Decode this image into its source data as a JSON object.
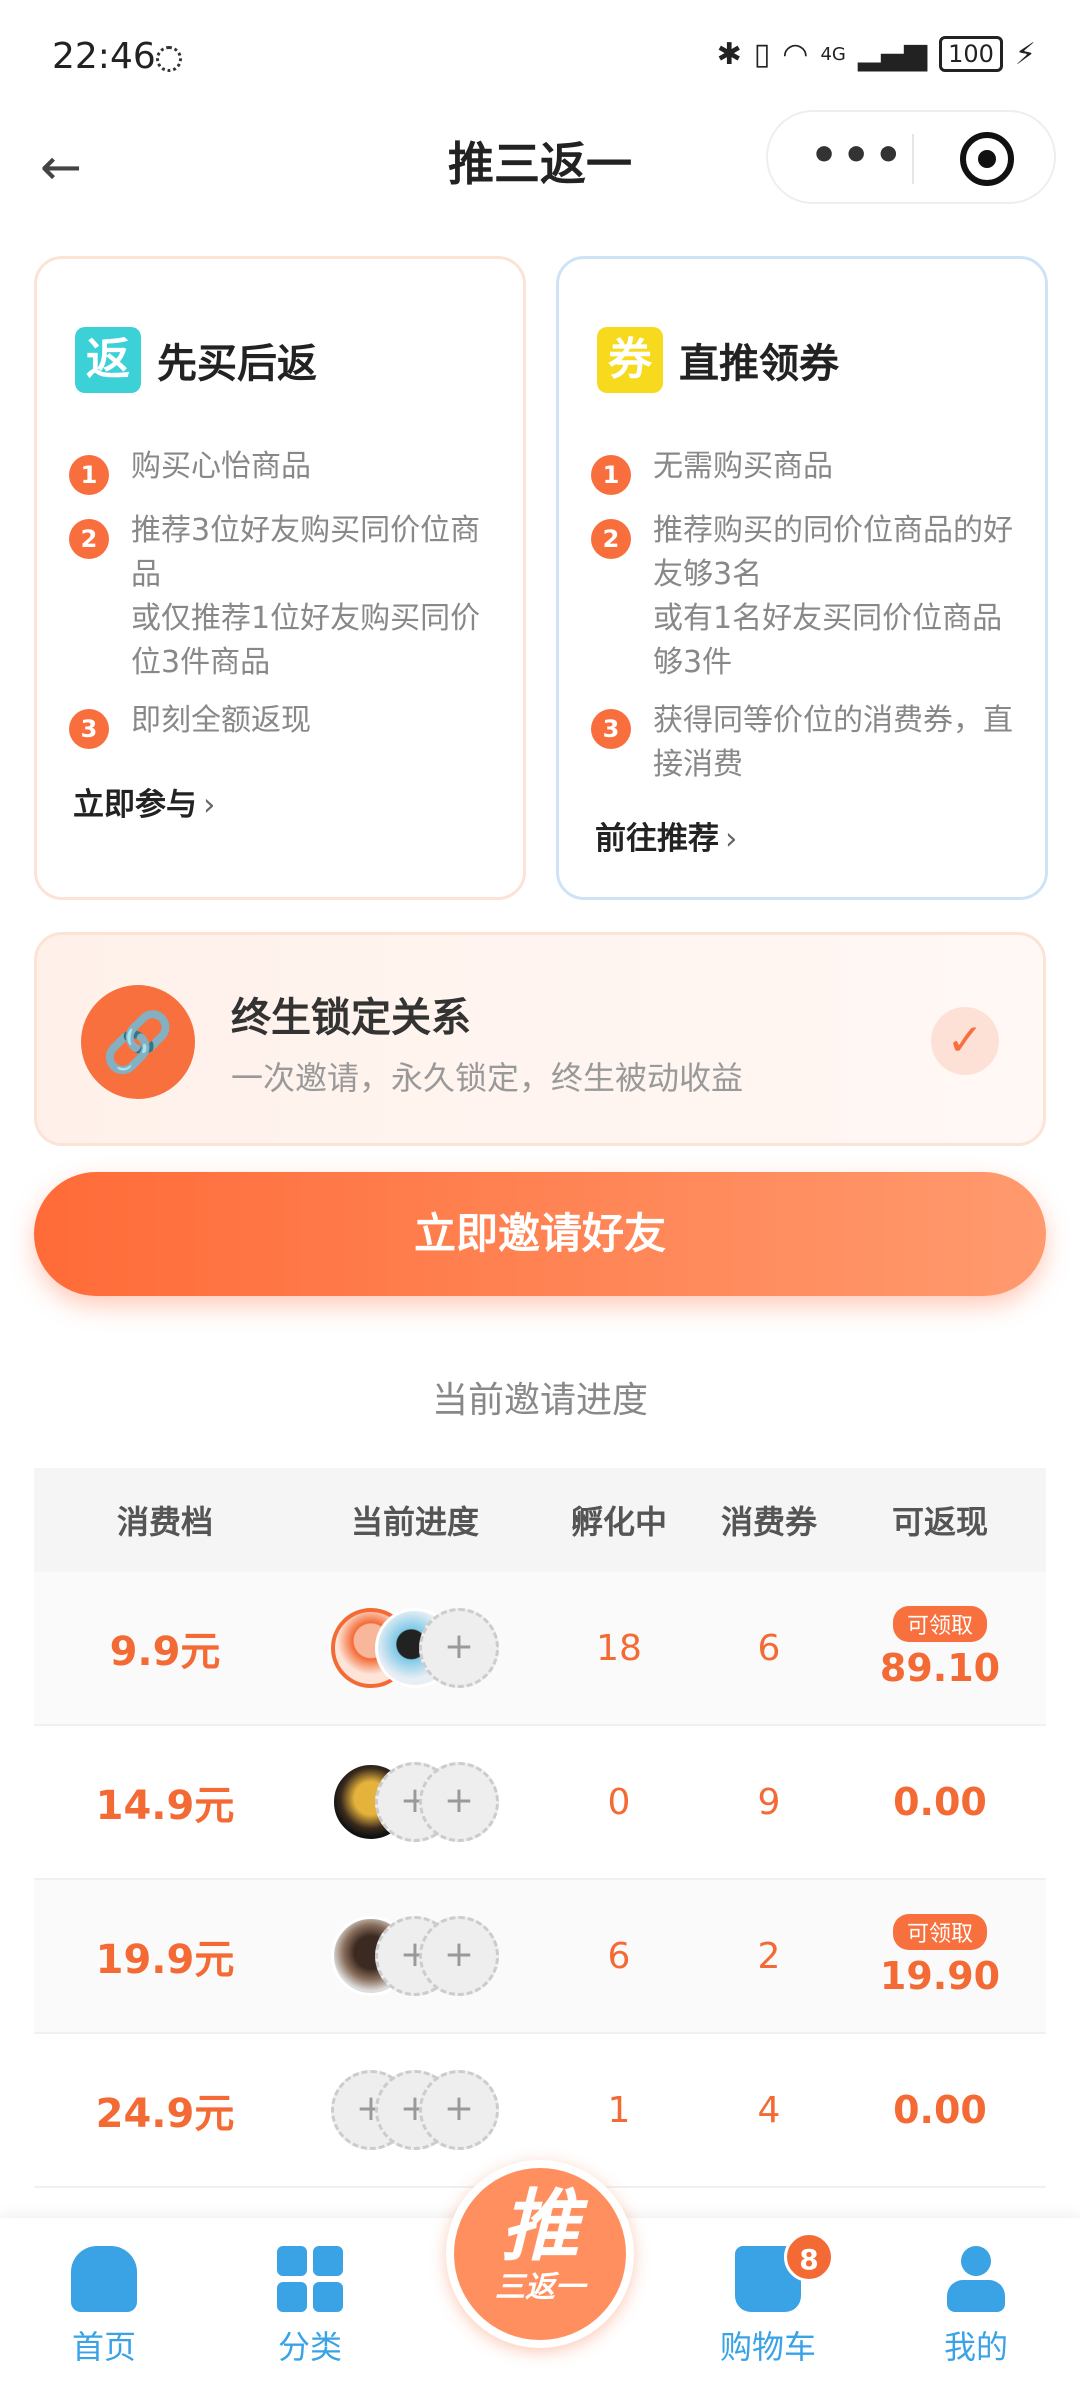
{
  "status_bar": {
    "time": "22:46",
    "network": "4G",
    "battery": "100"
  },
  "nav": {
    "title": "推三返一"
  },
  "cards": {
    "left": {
      "badge": "返",
      "title": "先买后返",
      "steps": [
        "购买心怡商品",
        "推荐3位好友购买同价位商品\n或仅推荐1位好友购买同价位3件商品",
        "即刻全额返现"
      ],
      "cta": "立即参与"
    },
    "right": {
      "badge": "券",
      "title": "直推领券",
      "steps": [
        "无需购买商品",
        "推荐购买的同价位商品的好友够3名\n或有1名好友买同价位商品够3件",
        "获得同等价位的消费券，直接消费"
      ],
      "cta": "前往推荐"
    }
  },
  "lock_banner": {
    "title": "终生锁定关系",
    "subtitle": "一次邀请，永久锁定，终生被动收益"
  },
  "invite_button": "立即邀请好友",
  "progress": {
    "title": "当前邀请进度",
    "headers": [
      "消费档",
      "当前进度",
      "孵化中",
      "消费券",
      "可返现"
    ],
    "tag": "可领取",
    "rows": [
      {
        "tier": "9.9元",
        "hatching": "18",
        "coupons": "6",
        "cashback": "89.10",
        "claimable": true
      },
      {
        "tier": "14.9元",
        "hatching": "0",
        "coupons": "9",
        "cashback": "0.00",
        "claimable": false
      },
      {
        "tier": "19.9元",
        "hatching": "6",
        "coupons": "2",
        "cashback": "19.90",
        "claimable": true
      },
      {
        "tier": "24.9元",
        "hatching": "1",
        "coupons": "4",
        "cashback": "0.00",
        "claimable": false
      }
    ]
  },
  "tabbar": {
    "home": "首页",
    "category": "分类",
    "center_big": "推",
    "center_small": "三返一",
    "cart": "购物车",
    "cart_badge": "8",
    "me": "我的"
  },
  "colors": {
    "accent": "#f46a35",
    "tab_blue": "#3aa3e6"
  }
}
